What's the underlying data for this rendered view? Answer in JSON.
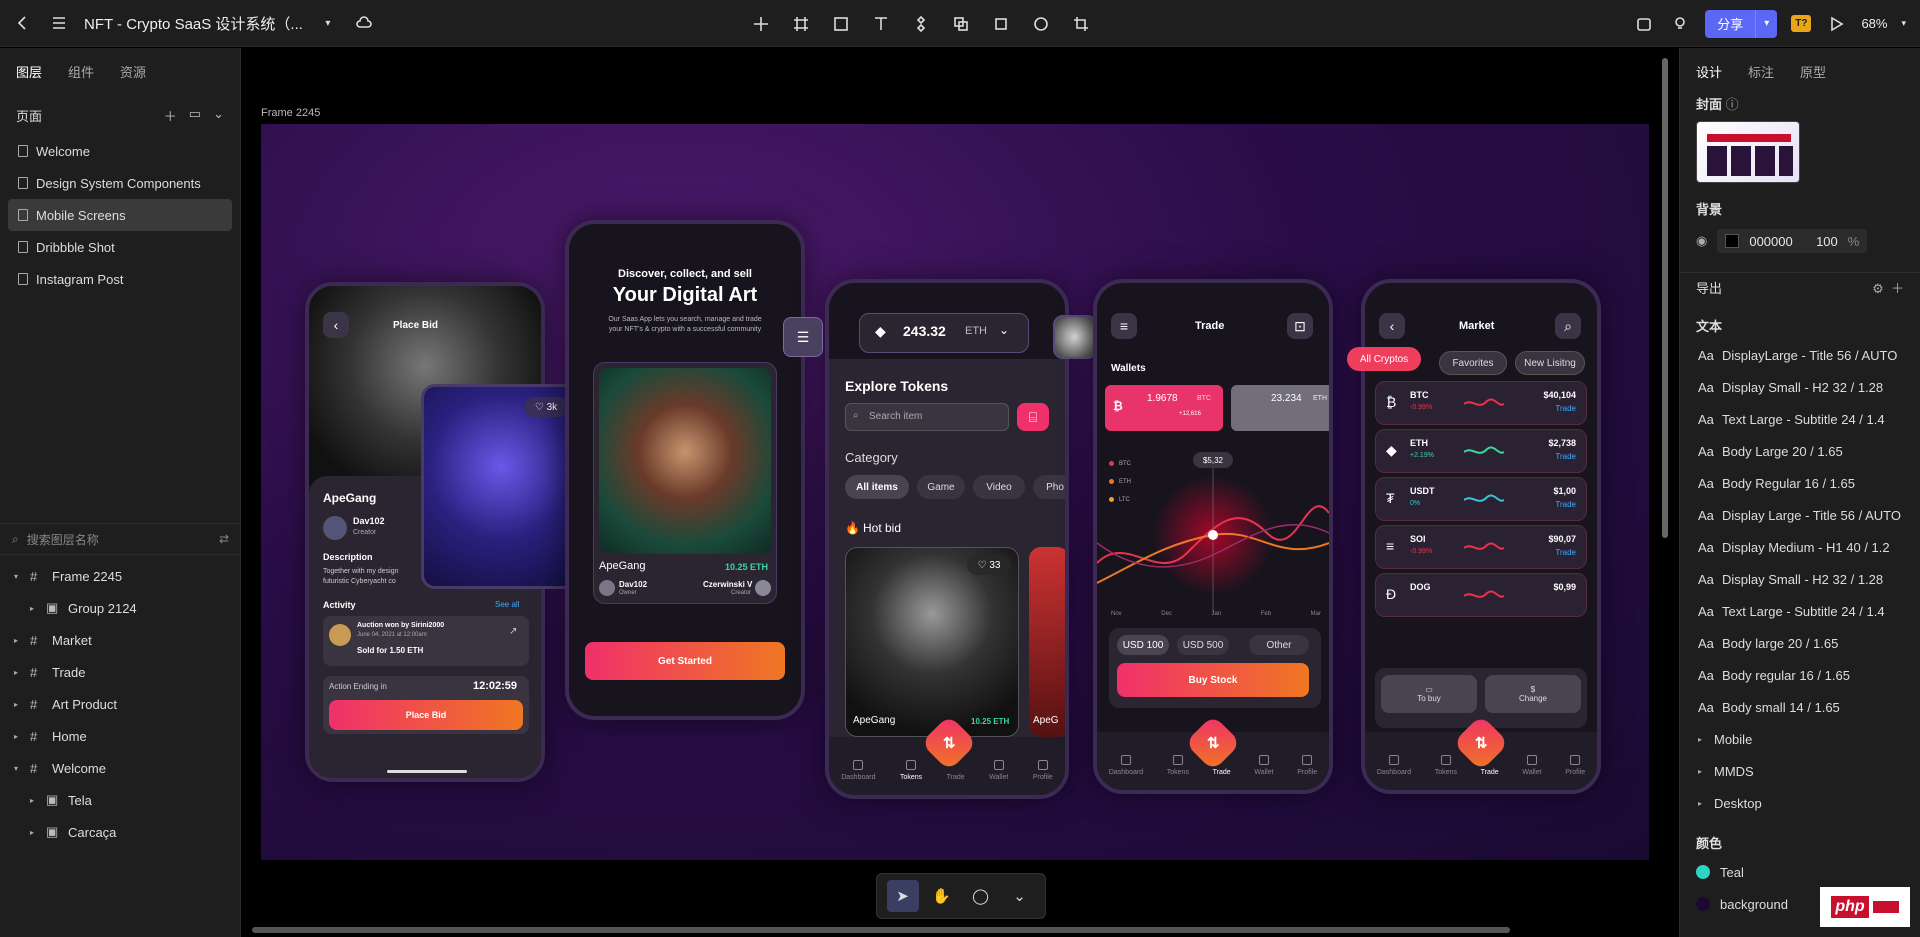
{
  "topbar": {
    "title": "NFT - Crypto SaaS 设计系统（...",
    "share": "分享",
    "badge": "T?",
    "zoom": "68%"
  },
  "left_panel": {
    "tabs": [
      "图层",
      "组件",
      "资源"
    ],
    "pages_header": "页面",
    "pages": [
      "Welcome",
      "Design System Components",
      "Mobile Screens",
      "Dribbble Shot",
      "Instagram Post"
    ],
    "selected_page": "Mobile Screens",
    "search_placeholder": "搜索图层名称",
    "layers": [
      {
        "name": "Frame 2245",
        "indent": 0,
        "expanded": true,
        "icon": "frame"
      },
      {
        "name": "Group 2124",
        "indent": 1,
        "expanded": false,
        "icon": "group"
      },
      {
        "name": "Market",
        "indent": 0,
        "expanded": false,
        "icon": "frame"
      },
      {
        "name": "Trade",
        "indent": 0,
        "expanded": false,
        "icon": "frame"
      },
      {
        "name": "Art Product",
        "indent": 0,
        "expanded": false,
        "icon": "frame"
      },
      {
        "name": "Home",
        "indent": 0,
        "expanded": false,
        "icon": "frame"
      },
      {
        "name": "Welcome",
        "indent": 0,
        "expanded": true,
        "icon": "frame"
      },
      {
        "name": "Tela",
        "indent": 1,
        "expanded": false,
        "icon": "group"
      },
      {
        "name": "Carcaça",
        "indent": 1,
        "expanded": false,
        "icon": "group"
      }
    ]
  },
  "canvas": {
    "frame_label": "Frame 2245",
    "phone1": {
      "place_bid_header": "Place Bid",
      "likes": "3k",
      "title": "ApeGang",
      "creator_name": "Dav102",
      "creator_role": "Creator",
      "desc_h": "Description",
      "desc": "Together with my design",
      "desc2": "futuristic Cyberyacht co",
      "activity": "Activity",
      "see_all": "See all",
      "auction_title": "Auction won by Sirini2000",
      "auction_date": "June 04, 2021 at 12:00am",
      "auction_sold": "Sold for 1.50 ETH",
      "ending_label": "Action Ending in",
      "timer": "12:02:59",
      "button": "Place Bid"
    },
    "phone2": {
      "headline_small": "Discover, collect, and sell",
      "headline": "Your Digital Art",
      "sub1": "Our Saas App lets you search, manage and trade",
      "sub2": "your NFT's & crypto with a successful community",
      "card_name": "ApeGang",
      "card_price": "10.25 ETH",
      "owner": "Dav102",
      "owner_role": "Owner",
      "creator": "Czerwinski V",
      "creator_role": "Creator",
      "button": "Get Started"
    },
    "phone3": {
      "balance": "243.32",
      "unit": "ETH",
      "explore": "Explore Tokens",
      "search_placeholder": "Search item",
      "category": "Category",
      "chips": [
        "All items",
        "Game",
        "Video",
        "Pho"
      ],
      "hot": "Hot bid",
      "card_likes": "33",
      "card_name": "ApeGang",
      "card_price": "10.25 ETH",
      "card2": "ApeG",
      "nav": [
        "Dashboard",
        "Tokens",
        "Trade",
        "Wallet",
        "Profile"
      ]
    },
    "phone4": {
      "title": "Trade",
      "wallets": "Wallets",
      "w1_value": "1.9678",
      "w1_unit": "BTC",
      "w1_change": "+12,616",
      "w2_value": "23.234",
      "w2_unit": "ETH",
      "legend": [
        "BTC",
        "ETH",
        "LTC"
      ],
      "tooltip": "$5,32",
      "months": [
        "Nov",
        "Dec",
        "Jan",
        "Feb",
        "Mar"
      ],
      "chips": [
        "USD 100",
        "USD 500",
        "Other"
      ],
      "button": "Buy Stock",
      "nav": [
        "Dashboard",
        "Tokens",
        "Trade",
        "Wallet",
        "Profile"
      ]
    },
    "phone5": {
      "title": "Market",
      "tabs": [
        "All Cryptos",
        "Favorites",
        "New Lisitng"
      ],
      "rows": [
        {
          "sym": "BTC",
          "change": "-0.99%",
          "price": "$40,104",
          "action": "Trade",
          "color": "#e8344f"
        },
        {
          "sym": "ETH",
          "change": "+2.19%",
          "price": "$2,738",
          "action": "Trade",
          "color": "#37d9a0"
        },
        {
          "sym": "USDT",
          "change": "0%",
          "price": "$1,00",
          "action": "Trade",
          "color": "#3ac4d8"
        },
        {
          "sym": "SOl",
          "change": "-0.99%",
          "price": "$90,07",
          "action": "Trade",
          "color": "#e8344f"
        },
        {
          "sym": "DOG",
          "change": "",
          "price": "$0,99",
          "action": "",
          "color": "#e8344f"
        }
      ],
      "buy": "To buy",
      "change": "Change",
      "nav": [
        "Dashboard",
        "Tokens",
        "Trade",
        "Wallet",
        "Profile"
      ]
    }
  },
  "right_panel": {
    "tabs": [
      "设计",
      "标注",
      "原型"
    ],
    "cover_label": "封面",
    "bg_label": "背景",
    "bg_color": "000000",
    "bg_opacity": "100",
    "bg_unit": "%",
    "export_label": "导出",
    "text_label": "文本",
    "text_styles": [
      "DisplayLarge - Title 56 / AUTO",
      "Display Small - H2 32 / 1.28",
      "Text Large - Subtitle 24 / 1.4",
      "Body Large 20 / 1.65",
      "Body Regular 16 / 1.65",
      "Display Large - Title 56 / AUTO",
      "Display Medium - H1 40 / 1.2",
      "Display Small - H2 32 / 1.28",
      "Text Large - Subtitle 24 / 1.4",
      "Body large 20 / 1.65",
      "Body regular 16 / 1.65",
      "Body small 14 / 1.65"
    ],
    "groups": [
      "Mobile",
      "MMDS",
      "Desktop"
    ],
    "color_label": "颜色",
    "colors": [
      {
        "name": "Teal",
        "hex": "#2ed3c6"
      },
      {
        "name": "background",
        "hex": "#1a0a32"
      }
    ],
    "watermark": "php"
  }
}
